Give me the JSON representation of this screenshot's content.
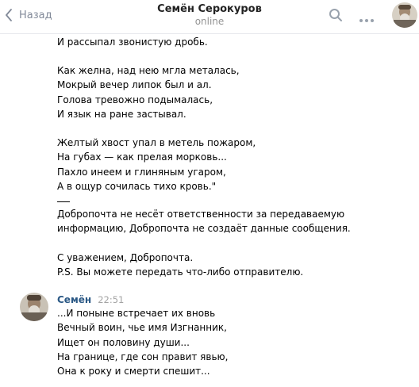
{
  "header": {
    "back_label": "Назад",
    "title": "Семён Серокуров",
    "status": "online"
  },
  "message1": {
    "poem_tail_1": "И рассыпал звонистую дробь.",
    "stanza_2": "Как желна, над нею мгла металась,\nМокрый вечер липок был и ал.\nГолова тревожно подымалась,\nИ язык на ране застывал.",
    "stanza_3": "Желтый хвост упал в метель пожаром,\nНа губах — как прелая морковь...\nПахло инеем и глиняным угаром,\nА в ощур сочилась тихо кровь.\"",
    "disclaimer": "Добропочта не несёт ответственности за передаваемую\nинформацию, Добропочта не создаёт данные сообщения.",
    "signature": "С уважением, Добропочта.\nP.S. Вы можете передать что-либо отправителю."
  },
  "message2": {
    "sender": "Семён",
    "time": "22:51",
    "text": "...И поныне встречает их вновь\nВечный воин, чье имя Изгнанник,\nИщет он половину души...\nНа границе, где сон правит явью,\nОна к року и смерти спешит..."
  },
  "colors": {
    "link": "#2a5885",
    "muted": "#828a99",
    "header_border": "#e7e8ec"
  },
  "icons": [
    "chevron-left-icon",
    "search-icon",
    "more-icon"
  ]
}
